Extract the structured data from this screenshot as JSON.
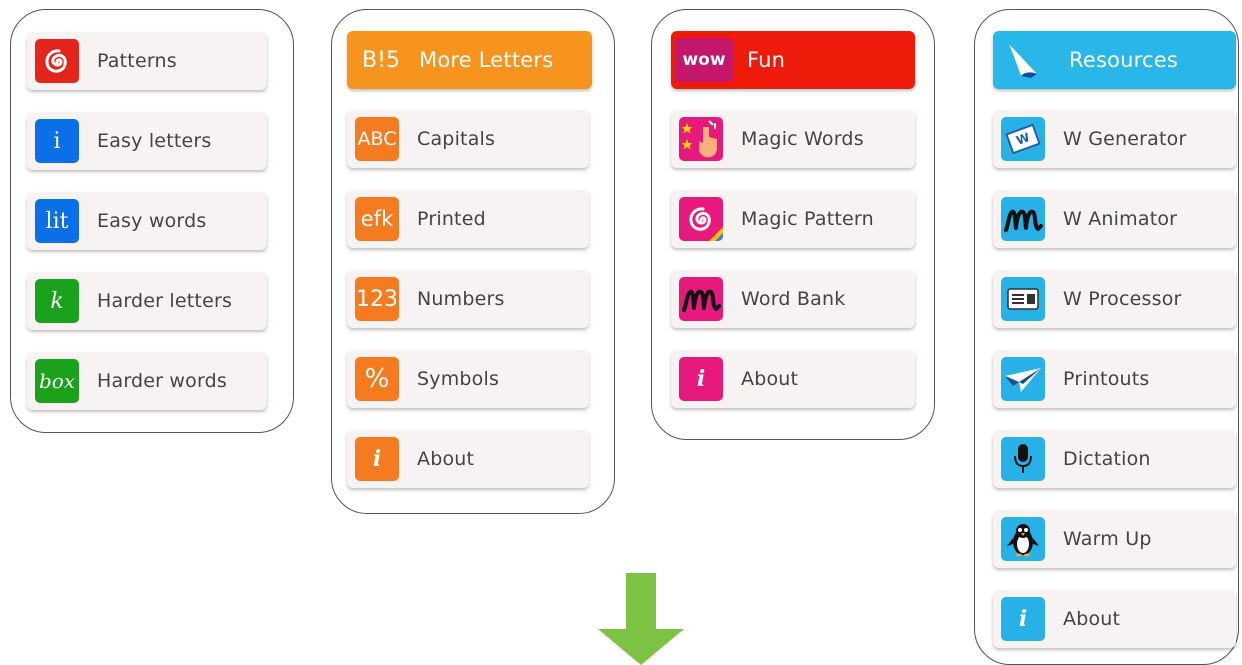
{
  "col1": {
    "items": [
      {
        "label": "Patterns",
        "icon": "spiral-icon"
      },
      {
        "label": "Easy letters",
        "icon": "letter-i-icon"
      },
      {
        "label": "Easy words",
        "icon": "word-lit-icon"
      },
      {
        "label": "Harder letters",
        "icon": "letter-k-icon"
      },
      {
        "label": "Harder words",
        "icon": "word-box-icon"
      }
    ],
    "icon_text": {
      "easy_letters": "i",
      "easy_words": "lit",
      "harder_letters": "k",
      "harder_words": "box"
    }
  },
  "col2": {
    "header": {
      "label": "More Letters",
      "icon_text": "B!5",
      "color": "#f7941d"
    },
    "items": [
      {
        "label": "Capitals",
        "icon_text": "ABC"
      },
      {
        "label": "Printed",
        "icon_text": "efk"
      },
      {
        "label": "Numbers",
        "icon_text": "123"
      },
      {
        "label": "Symbols",
        "icon_text": "%"
      },
      {
        "label": "About",
        "icon_text": "i"
      }
    ]
  },
  "col3": {
    "header": {
      "label": "Fun",
      "icon_text": "wow",
      "color": "#ef1b0a"
    },
    "items": [
      {
        "label": "Magic Words",
        "icon": "magic-hand-icon"
      },
      {
        "label": "Magic Pattern",
        "icon": "magic-spiral-icon"
      },
      {
        "label": "Word Bank",
        "icon": "cursive-m-icon"
      },
      {
        "label": "About",
        "icon_text": "i"
      }
    ]
  },
  "col4": {
    "header": {
      "label": "Resources",
      "icon": "page-curl-icon",
      "color": "#29b6e8"
    },
    "items": [
      {
        "label": "W Generator",
        "icon_text": "W"
      },
      {
        "label": "W Animator",
        "icon": "cursive-m-icon"
      },
      {
        "label": "W Processor",
        "icon": "document-icon"
      },
      {
        "label": "Printouts",
        "icon": "paper-plane-icon"
      },
      {
        "label": "Dictation",
        "icon": "microphone-icon"
      },
      {
        "label": "Warm Up",
        "icon": "penguin-icon"
      },
      {
        "label": "About",
        "icon_text": "i"
      }
    ]
  },
  "arrow_color": "#7dc242"
}
